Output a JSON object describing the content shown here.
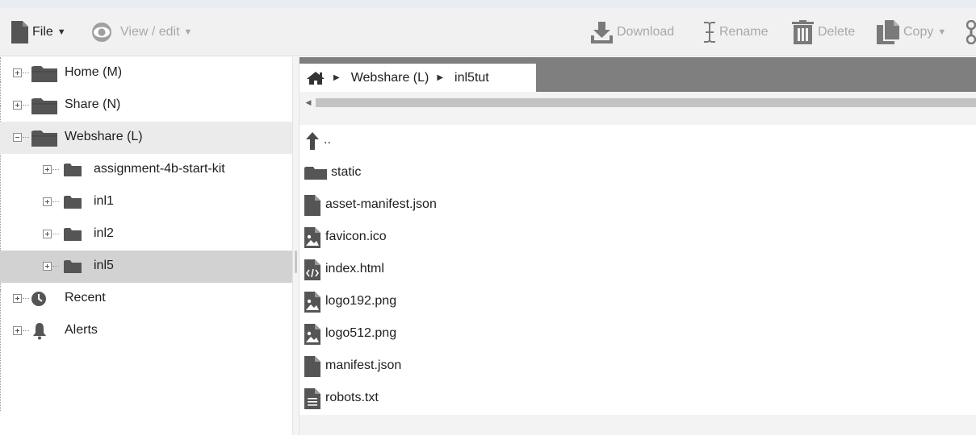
{
  "toolbar": {
    "file_label": "File",
    "view_label": "View / edit",
    "download_label": "Download",
    "rename_label": "Rename",
    "delete_label": "Delete",
    "copy_label": "Copy"
  },
  "sidebar": {
    "items": [
      {
        "label": "Home (M)",
        "icon": "folder-icon"
      },
      {
        "label": "Share (N)",
        "icon": "folder-icon"
      },
      {
        "label": "Webshare (L)",
        "icon": "folder-icon",
        "expanded": true
      },
      {
        "label": "assignment-4b-start-kit",
        "icon": "folder-icon"
      },
      {
        "label": "inl1",
        "icon": "folder-icon"
      },
      {
        "label": "inl2",
        "icon": "folder-icon"
      },
      {
        "label": "inl5",
        "icon": "folder-icon",
        "selected": true
      },
      {
        "label": "Recent",
        "icon": "clock-icon"
      },
      {
        "label": "Alerts",
        "icon": "bell-icon"
      }
    ]
  },
  "breadcrumb": {
    "items": [
      "Webshare (L)",
      "inl5tut"
    ]
  },
  "files": [
    {
      "name": "..",
      "icon": "up-arrow-icon"
    },
    {
      "name": "static",
      "icon": "folder-icon"
    },
    {
      "name": "asset-manifest.json",
      "icon": "file-icon"
    },
    {
      "name": "favicon.ico",
      "icon": "image-file-icon"
    },
    {
      "name": "index.html",
      "icon": "code-file-icon"
    },
    {
      "name": "logo192.png",
      "icon": "image-file-icon"
    },
    {
      "name": "logo512.png",
      "icon": "image-file-icon"
    },
    {
      "name": "manifest.json",
      "icon": "file-icon"
    },
    {
      "name": "robots.txt",
      "icon": "text-file-icon"
    }
  ],
  "colors": {
    "icon_dark": "#555555",
    "breadcrumb_bar": "#7f7f7f",
    "selected_row": "#d2d2d2",
    "disabled_text": "#a8a8a8"
  }
}
